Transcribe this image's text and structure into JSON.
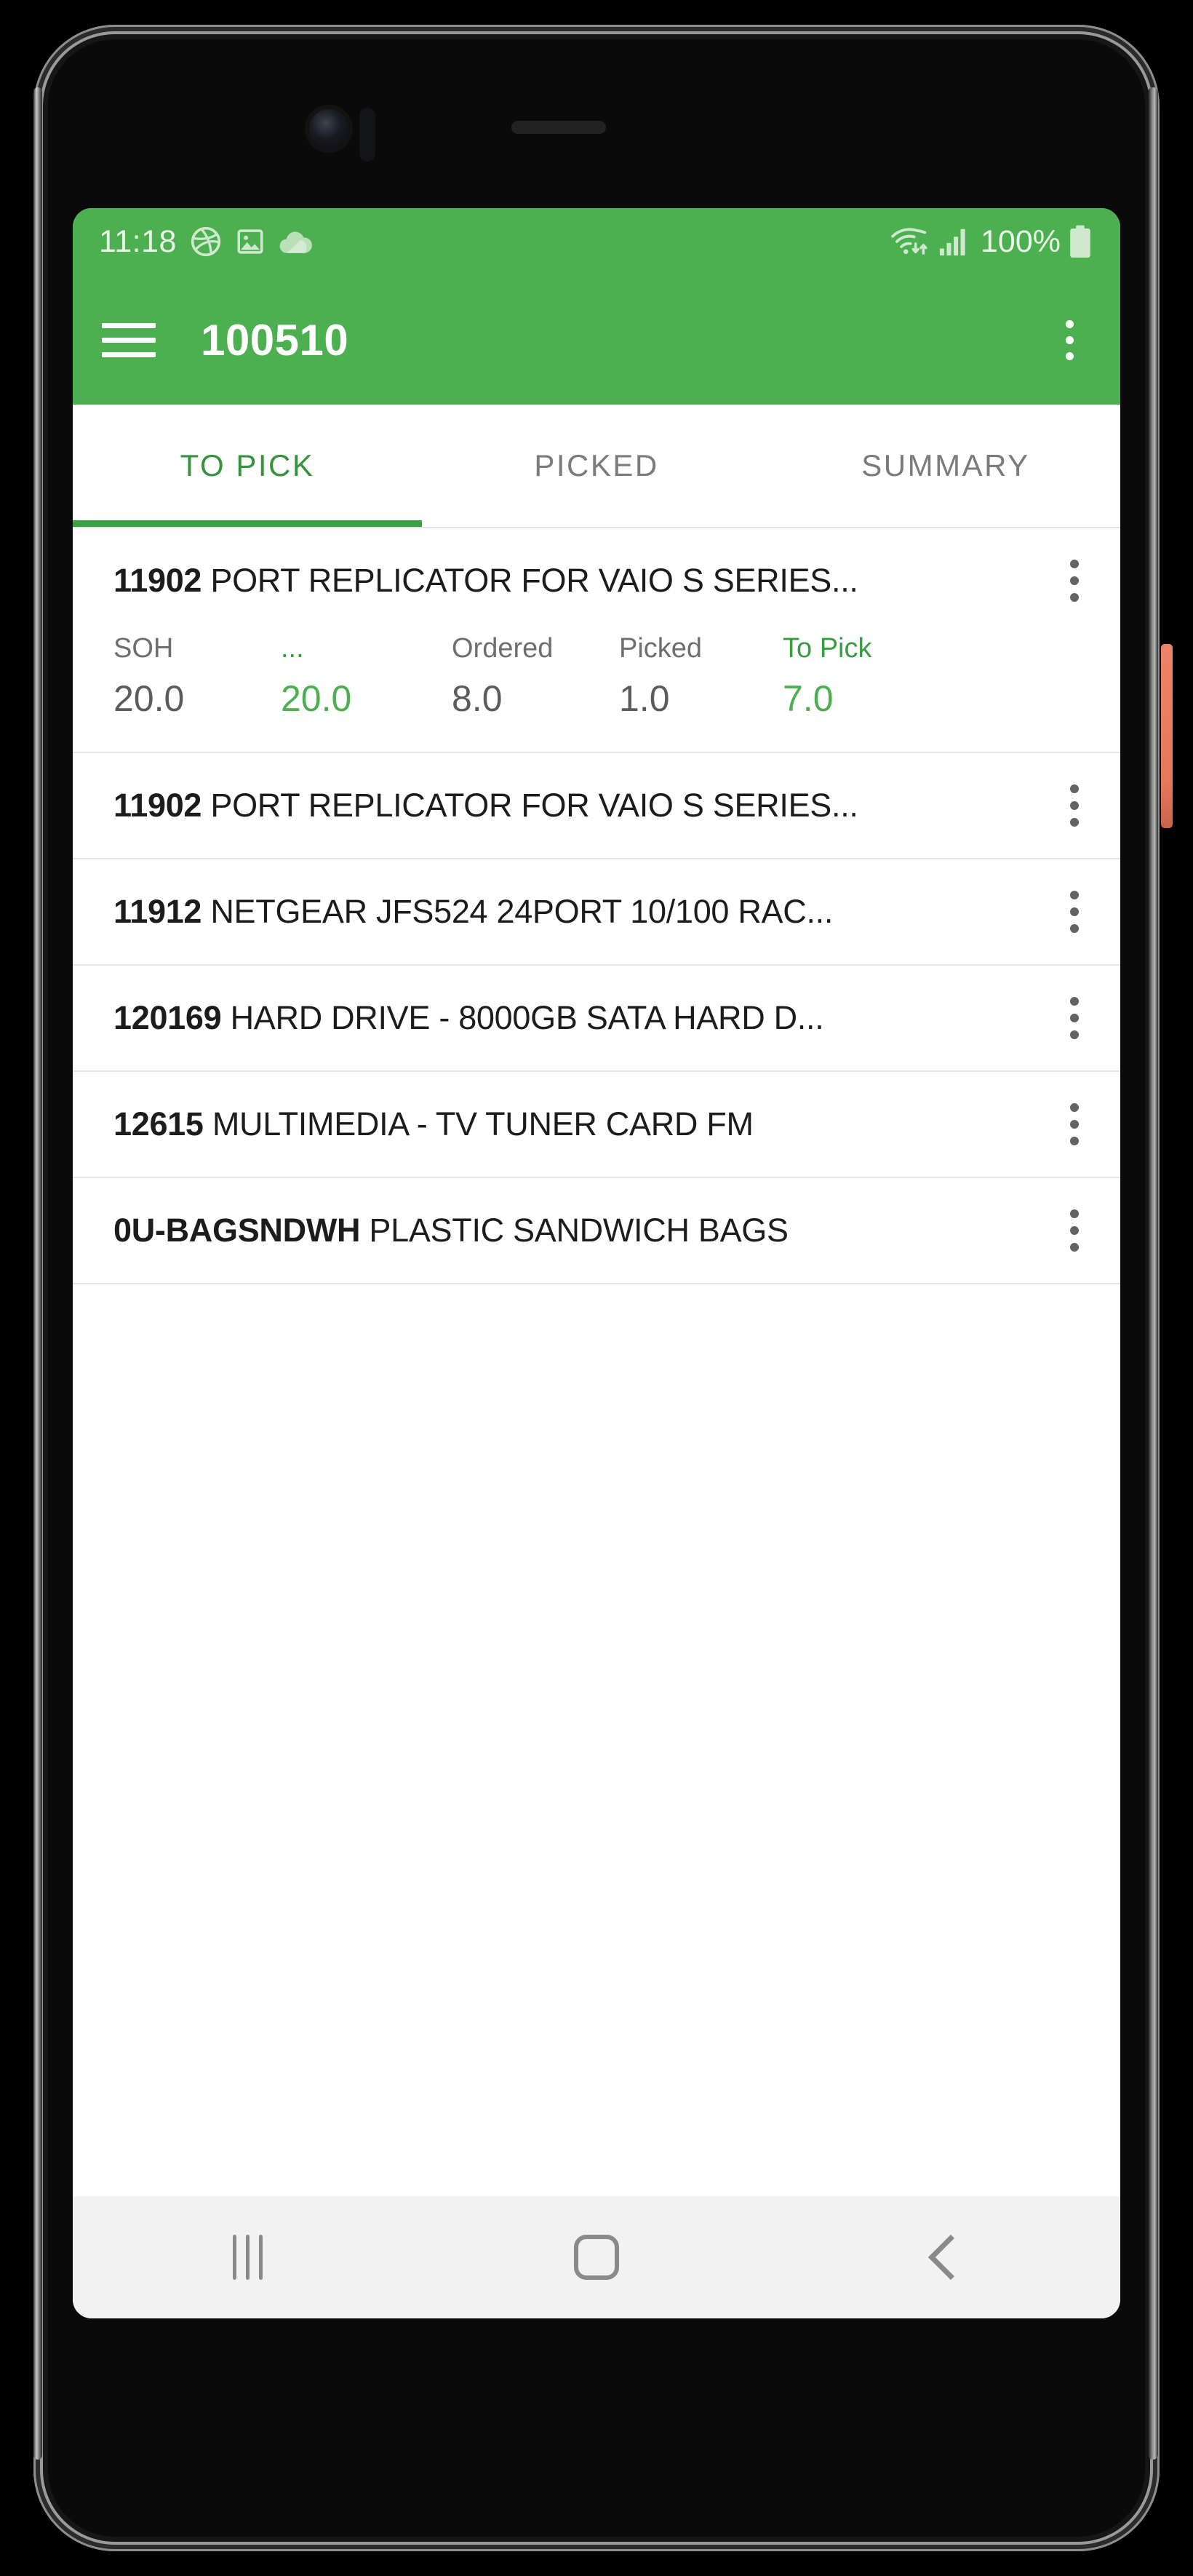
{
  "status_bar": {
    "time": "11:18",
    "battery_percent": "100%",
    "icons": [
      "dribbble-icon",
      "image-icon",
      "cloud-icon",
      "wifi-icon",
      "signal-icon",
      "battery-icon"
    ]
  },
  "app_bar": {
    "menu_icon": "hamburger-menu-icon",
    "title": "100510",
    "overflow_icon": "more-vertical-icon"
  },
  "tabs": [
    {
      "label": "TO PICK",
      "active": true
    },
    {
      "label": "PICKED",
      "active": false
    },
    {
      "label": "SUMMARY",
      "active": false
    }
  ],
  "colors": {
    "primary_green": "#4CAF50",
    "accent_green": "#3ba242",
    "text_dark": "#1c1c1c",
    "text_muted": "#6e6e6e",
    "divider": "#e6e6e6"
  },
  "list": {
    "detail_headers": {
      "soh": "SOH",
      "available": "...",
      "ordered": "Ordered",
      "picked": "Picked",
      "to_pick": "To Pick"
    },
    "items": [
      {
        "sku": "11902",
        "description": "PORT REPLICATOR FOR VAIO S SERIES...",
        "expanded": true,
        "details": {
          "soh": "20.0",
          "available": "20.0",
          "ordered": "8.0",
          "picked": "1.0",
          "to_pick": "7.0"
        }
      },
      {
        "sku": "11902",
        "description": "PORT REPLICATOR FOR VAIO S SERIES...",
        "expanded": false
      },
      {
        "sku": "11912",
        "description": "NETGEAR JFS524 24PORT 10/100 RAC...",
        "expanded": false
      },
      {
        "sku": "120169",
        "description": "HARD DRIVE - 8000GB SATA HARD D...",
        "expanded": false
      },
      {
        "sku": "12615",
        "description": "MULTIMEDIA - TV TUNER CARD FM",
        "expanded": false
      },
      {
        "sku": "0U-BAGSNDWH",
        "description": "PLASTIC SANDWICH BAGS",
        "expanded": false
      }
    ]
  },
  "nav_bar": {
    "recents": "recents-icon",
    "home": "home-icon",
    "back": "back-icon"
  }
}
